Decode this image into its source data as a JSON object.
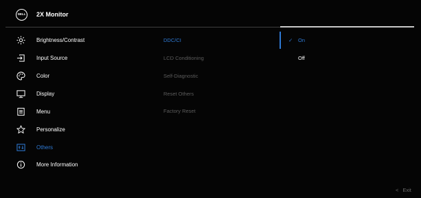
{
  "header": {
    "logo_text": "DELL",
    "model": "2X Monitor"
  },
  "menu": {
    "items": [
      {
        "label": "Brightness/Contrast",
        "icon": "brightness-icon"
      },
      {
        "label": "Input Source",
        "icon": "input-source-icon"
      },
      {
        "label": "Color",
        "icon": "palette-icon"
      },
      {
        "label": "Display",
        "icon": "monitor-icon"
      },
      {
        "label": "Menu",
        "icon": "menu-list-icon"
      },
      {
        "label": "Personalize",
        "icon": "star-icon"
      },
      {
        "label": "Others",
        "icon": "others-icon"
      },
      {
        "label": "More Information",
        "icon": "info-icon"
      }
    ],
    "active": "Others"
  },
  "submenu": {
    "items": [
      {
        "label": "DDC/CI"
      },
      {
        "label": "LCD Conditioning"
      },
      {
        "label": "Self-Diagnostic"
      },
      {
        "label": "Reset Others"
      },
      {
        "label": "Factory Reset"
      }
    ],
    "active": "DDC/CI"
  },
  "options": {
    "items": [
      {
        "label": "On"
      },
      {
        "label": "Off"
      }
    ],
    "selected": "On"
  },
  "footer": {
    "exit_label": "Exit"
  },
  "colors": {
    "accent": "#2f7bd6",
    "background": "#050505",
    "inactive_text": "#5c5c5c"
  }
}
